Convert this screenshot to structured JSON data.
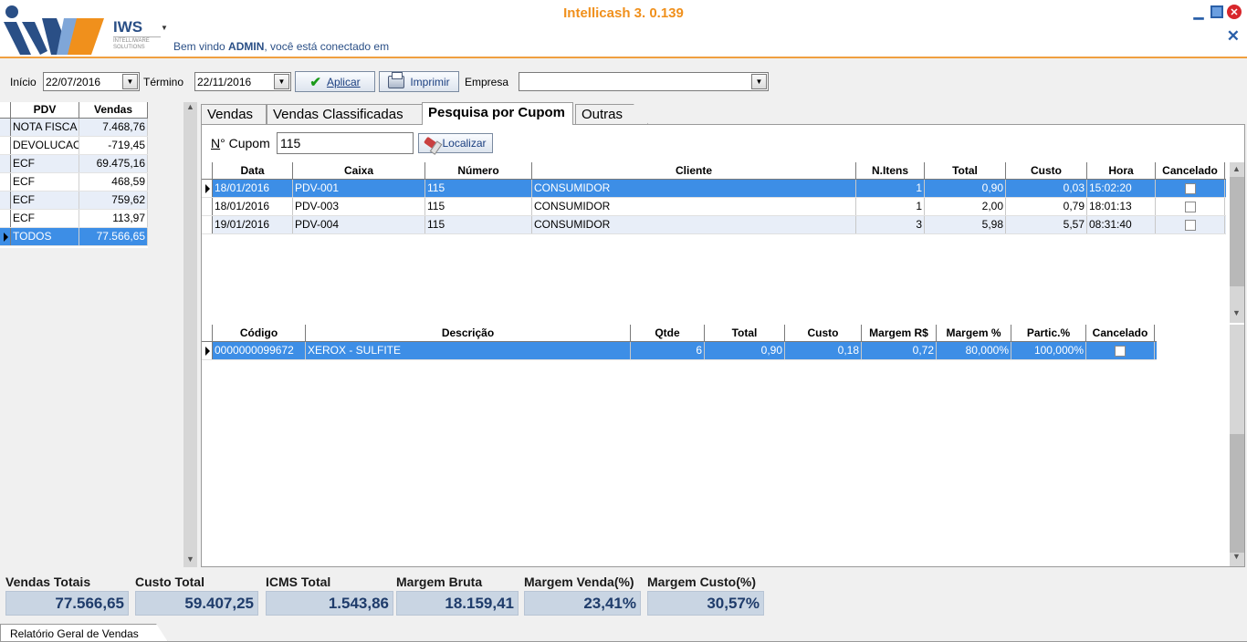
{
  "header": {
    "app_title": "Intellicash 3. 0.139",
    "logo_text": "IWS",
    "logo_sub": "INTELLIWARE SOLUTIONS",
    "welcome_prefix": "Bem vindo ",
    "welcome_user": "ADMIN",
    "welcome_suffix": ", você está conectado em"
  },
  "toolbar": {
    "inicio_label": "Início",
    "inicio_value": "22/07/2016",
    "termino_label": "Término",
    "termino_value": "22/11/2016",
    "aplicar_label": "Aplicar",
    "imprimir_label": "Imprimir",
    "empresa_label": "Empresa",
    "empresa_value": ""
  },
  "pdv_grid": {
    "headers": [
      "PDV",
      "Vendas"
    ],
    "rows": [
      {
        "pdv": "NOTA FISCA",
        "vendas": "7.468,76"
      },
      {
        "pdv": "DEVOLUCAO",
        "vendas": "-719,45"
      },
      {
        "pdv": "ECF",
        "vendas": "69.475,16"
      },
      {
        "pdv": "ECF",
        "vendas": "468,59"
      },
      {
        "pdv": "ECF",
        "vendas": "759,62"
      },
      {
        "pdv": "ECF",
        "vendas": "113,97"
      },
      {
        "pdv": "TODOS",
        "vendas": "77.566,65"
      }
    ],
    "selected_index": 6
  },
  "tabs": [
    {
      "label": "Vendas"
    },
    {
      "label": "Vendas Classificadas"
    },
    {
      "label": "Pesquisa por Cupom"
    },
    {
      "label": "Outras"
    }
  ],
  "active_tab": 2,
  "cupom": {
    "label_n": "N",
    "label_rest": "° Cupom",
    "value": "115",
    "localizar_label": "Localizar"
  },
  "sales_grid": {
    "headers": [
      "Data",
      "Caixa",
      "Número",
      "Cliente",
      "N.Itens",
      "Total",
      "Custo",
      "Hora",
      "Cancelado"
    ],
    "rows": [
      {
        "data": "18/01/2016",
        "caixa": "PDV-001",
        "numero": "115",
        "cliente": "CONSUMIDOR",
        "itens": "1",
        "total": "0,90",
        "custo": "0,03",
        "hora": "15:02:20"
      },
      {
        "data": "18/01/2016",
        "caixa": "PDV-003",
        "numero": "115",
        "cliente": "CONSUMIDOR",
        "itens": "1",
        "total": "2,00",
        "custo": "0,79",
        "hora": "18:01:13"
      },
      {
        "data": "19/01/2016",
        "caixa": "PDV-004",
        "numero": "115",
        "cliente": "CONSUMIDOR",
        "itens": "3",
        "total": "5,98",
        "custo": "5,57",
        "hora": "08:31:40"
      }
    ]
  },
  "items_grid": {
    "headers": [
      "Código",
      "Descrição",
      "Qtde",
      "Total",
      "Custo",
      "Margem R$",
      "Margem %",
      "Partic.%",
      "Cancelado"
    ],
    "rows": [
      {
        "codigo": "0000000099672",
        "descricao": "XEROX - SULFITE",
        "qtde": "6",
        "total": "0,90",
        "custo": "0,18",
        "margem_rs": "0,72",
        "margem_pct": "80,000%",
        "partic": "100,000%"
      }
    ]
  },
  "totals": [
    {
      "label": "Vendas Totais",
      "value": "77.566,65"
    },
    {
      "label": "Custo Total",
      "value": "59.407,25"
    },
    {
      "label": "ICMS Total",
      "value": "1.543,86"
    },
    {
      "label": "Margem Bruta",
      "value": "18.159,41"
    },
    {
      "label": "Margem Venda(%)",
      "value": "23,41%"
    },
    {
      "label": "Margem Custo(%)",
      "value": "30,57%"
    }
  ],
  "status_tab": "Relatório Geral de Vendas",
  "colors": {
    "accent": "#f0901c",
    "brand": "#2a4f86",
    "selection": "#3d8ee6"
  }
}
